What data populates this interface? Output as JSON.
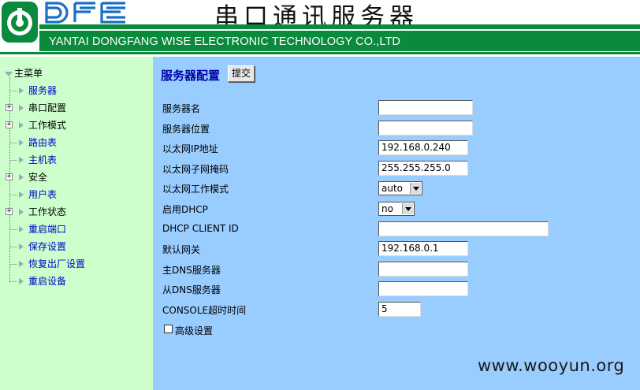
{
  "header": {
    "logo_text": "DFE",
    "title": "串口通讯服务器",
    "company": "YANTAI DONGFANG WISE ELECTRONIC TECHNOLOGY CO.,LTD"
  },
  "sidebar": {
    "root": "主菜单",
    "items": [
      {
        "label": "服务器",
        "expandable": false,
        "link": true
      },
      {
        "label": "串口配置",
        "expandable": true,
        "link": false
      },
      {
        "label": "工作模式",
        "expandable": true,
        "link": false
      },
      {
        "label": "路由表",
        "expandable": false,
        "link": true
      },
      {
        "label": "主机表",
        "expandable": false,
        "link": true
      },
      {
        "label": "安全",
        "expandable": true,
        "link": false
      },
      {
        "label": "用户表",
        "expandable": false,
        "link": true
      },
      {
        "label": "工作状态",
        "expandable": true,
        "link": false
      },
      {
        "label": "重启端口",
        "expandable": false,
        "link": true
      },
      {
        "label": "保存设置",
        "expandable": false,
        "link": true
      },
      {
        "label": "恢复出厂设置",
        "expandable": false,
        "link": true
      },
      {
        "label": "重启设备",
        "expandable": false,
        "link": true
      }
    ]
  },
  "main": {
    "title": "服务器配置",
    "submit_label": "提交",
    "fields": [
      {
        "label": "服务器名",
        "type": "text",
        "value": ""
      },
      {
        "label": "服务器位置",
        "type": "text",
        "value": ""
      },
      {
        "label": "以太网IP地址",
        "type": "text",
        "value": "192.168.0.240"
      },
      {
        "label": "以太网子网掩码",
        "type": "text",
        "value": "255.255.255.0"
      },
      {
        "label": "以太网工作模式",
        "type": "select",
        "value": "auto"
      },
      {
        "label": "启用DHCP",
        "type": "select",
        "value": "no"
      },
      {
        "label": "DHCP CLIENT ID",
        "type": "text",
        "value": ""
      },
      {
        "label": "默认网关",
        "type": "text",
        "value": "192.168.0.1"
      },
      {
        "label": "主DNS服务器",
        "type": "text",
        "value": ""
      },
      {
        "label": "从DNS服务器",
        "type": "text",
        "value": ""
      },
      {
        "label": "CONSOLE超时时间",
        "type": "text",
        "value": "5"
      }
    ],
    "advanced_label": "高级设置",
    "advanced_checked": false
  },
  "watermark": "www.wooyun.org",
  "colors": {
    "header_green": "#0a8a3c",
    "sidebar_bg": "#ccffcc",
    "main_bg": "#99ccff",
    "link": "#0000cc",
    "title": "#0000aa"
  }
}
